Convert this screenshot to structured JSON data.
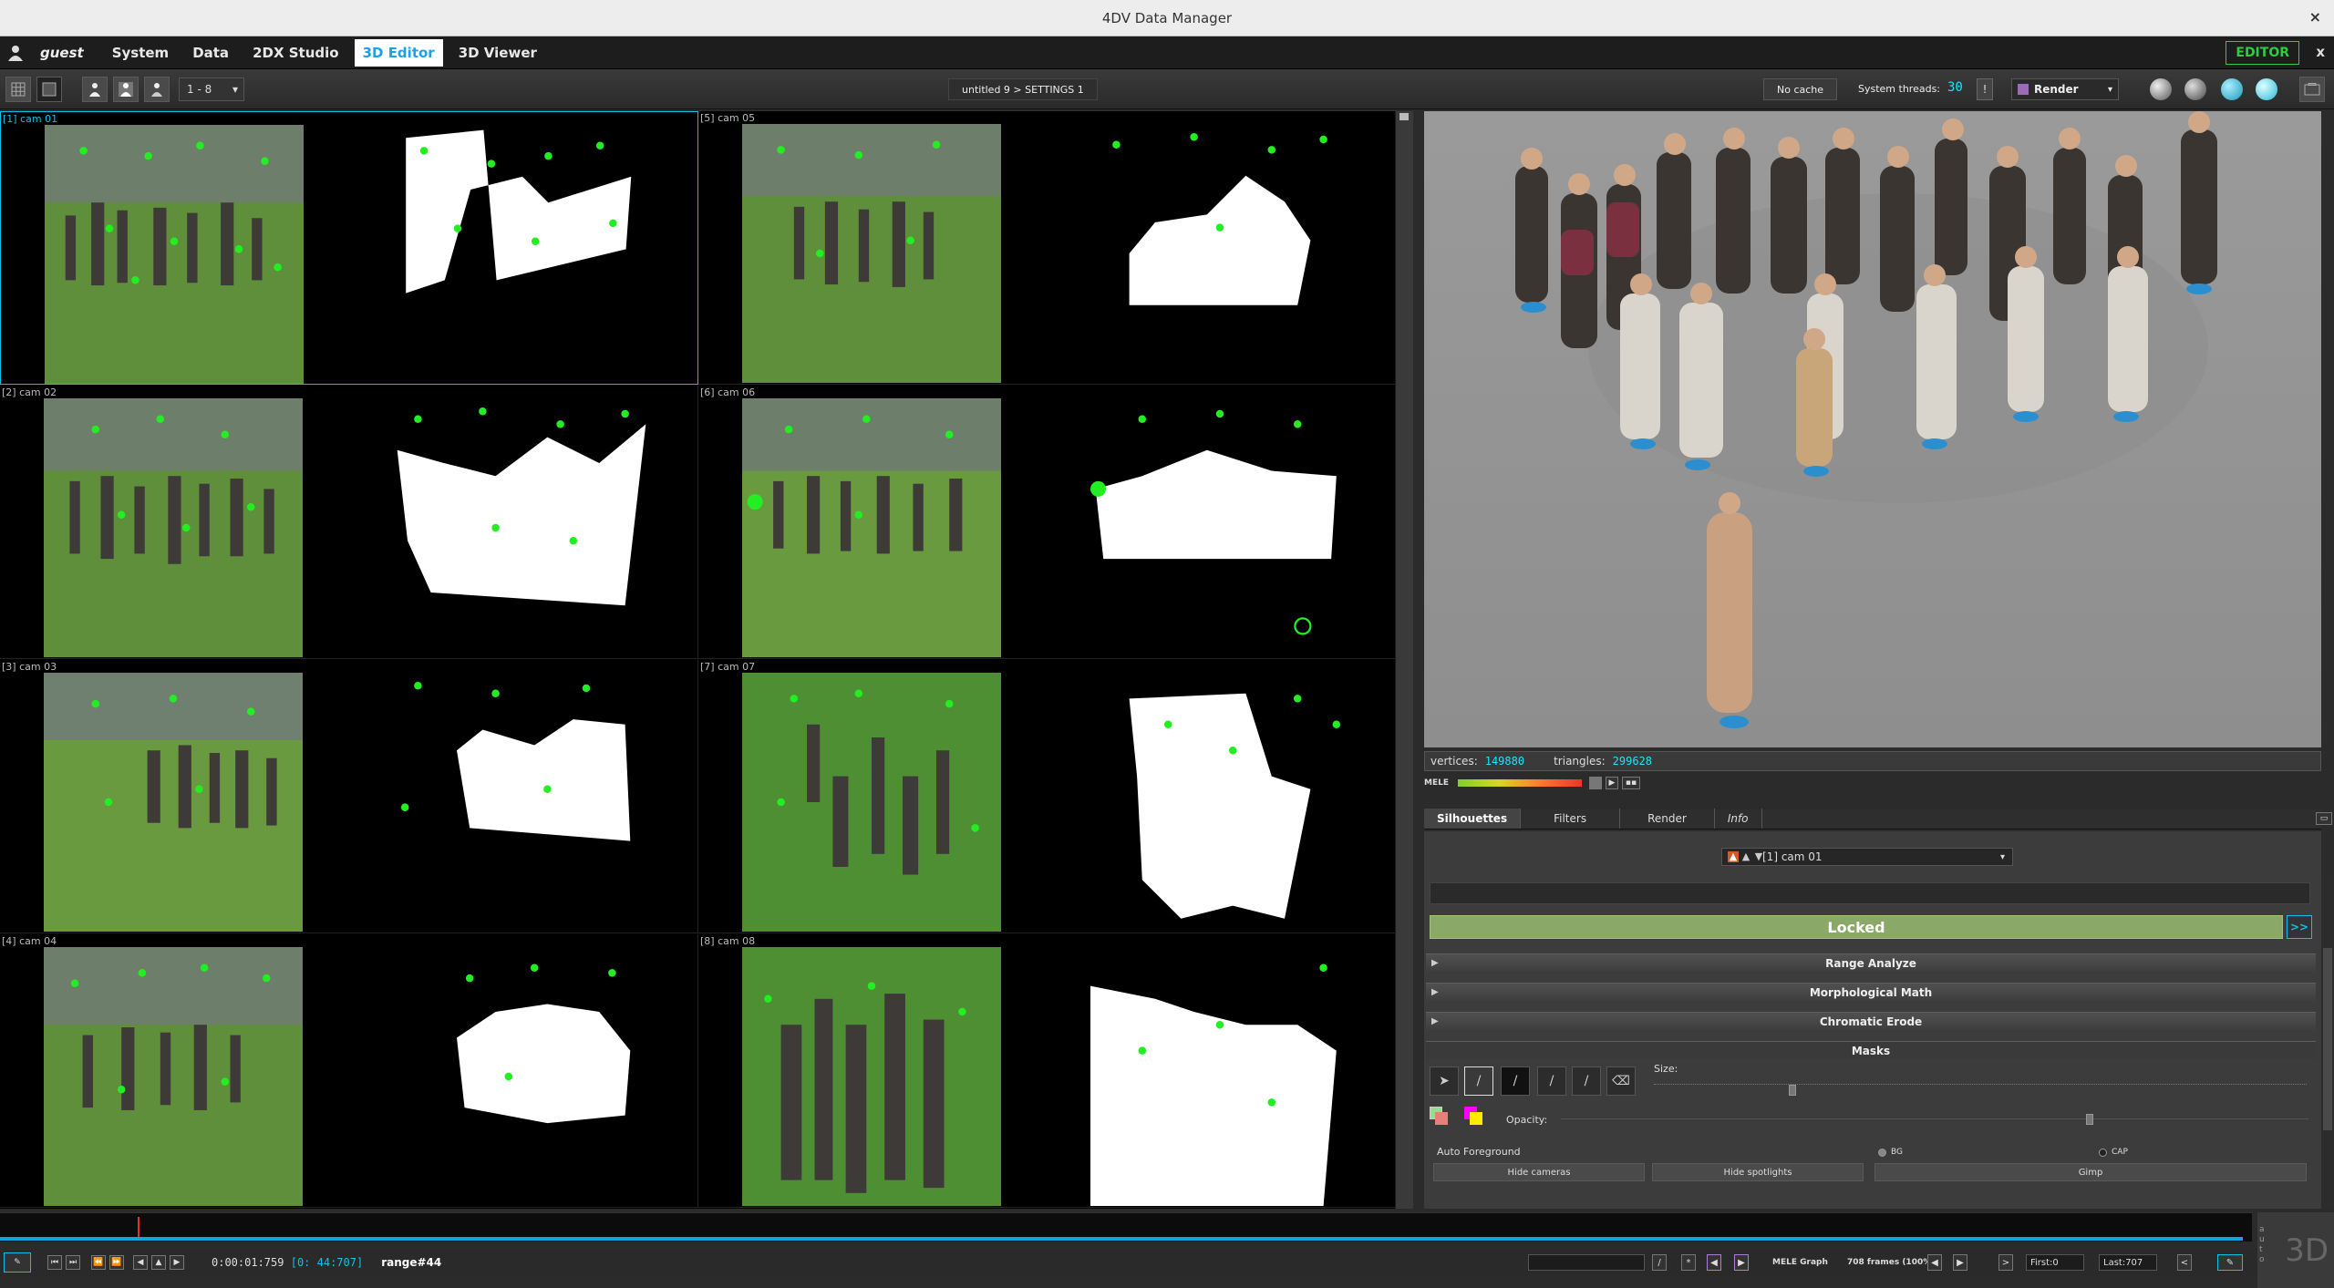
{
  "window": {
    "title": "4DV Data Manager",
    "close": "×"
  },
  "menu": {
    "user": "guest",
    "items": [
      "System",
      "Data",
      "2DX Studio",
      "3D Editor",
      "3D Viewer"
    ],
    "active": "3D Editor",
    "editor_badge": "EDITOR",
    "close": "x"
  },
  "toolbar": {
    "range": "1 - 8",
    "project_path": "untitled 9 > SETTINGS 1",
    "cache": "No cache",
    "threads_label": "System threads:",
    "threads_value": "30",
    "threads_warn": "!",
    "render_mode": "Render",
    "render_color": "#9b6bb6"
  },
  "cameras": [
    {
      "label": "[1] cam 01"
    },
    {
      "label": "[2] cam 02"
    },
    {
      "label": "[3] cam 03"
    },
    {
      "label": "[4] cam 04"
    },
    {
      "label": "[5] cam 05"
    },
    {
      "label": "[6] cam 06"
    },
    {
      "label": "[7] cam 07"
    },
    {
      "label": "[8] cam 08"
    }
  ],
  "viewport": {
    "vertices_label": "vertices:",
    "vertices": "149880",
    "triangles_label": "triangles:",
    "triangles": "299628",
    "mele_label": "MELE"
  },
  "tabs": [
    "Silhouettes",
    "Filters",
    "Render",
    "Info"
  ],
  "silhouettes": {
    "camera": "[1] cam 01",
    "status": "Locked",
    "more": ">>",
    "sections": [
      "Range Analyze",
      "Morphological Math",
      "Chromatic Erode",
      "Masks"
    ],
    "size_label": "Size:",
    "opacity_label": "Opacity:",
    "auto_foreground": "Auto Foreground",
    "bg_label": "BG",
    "cap_label": "CAP",
    "hide_cameras": "Hide cameras",
    "hide_spotlights": "Hide spotlights",
    "gimp": "Gimp"
  },
  "timeline": {
    "timecode": "0:00:01:759",
    "timecode_sub": "[0: 44:707]",
    "range": "range#44",
    "graph_label": "MELE Graph",
    "frames": "708 frames (100%)",
    "first": "First:0",
    "last": "Last:707",
    "slash": "/",
    "star": "*",
    "gt": ">",
    "lt": "<",
    "mode_3d": "3D",
    "auto": "auto"
  }
}
